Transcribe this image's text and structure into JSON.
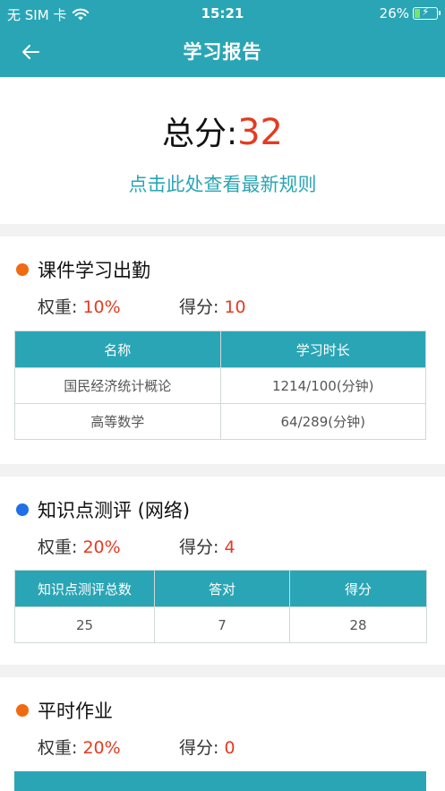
{
  "status_bar": {
    "carrier": "无 SIM 卡",
    "time": "15:21",
    "battery": "26%"
  },
  "nav": {
    "title": "学习报告"
  },
  "summary": {
    "total_label": "总分:",
    "total_value": "32",
    "rules_link": "点击此处查看最新规则"
  },
  "sections": [
    {
      "title": "课件学习出勤",
      "dot_color": "#f06a12",
      "weight_label": "权重:",
      "weight_value": "10%",
      "score_label": "得分:",
      "score_value": "10",
      "headers": [
        "名称",
        "学习时长"
      ],
      "rows": [
        [
          "国民经济统计概论",
          "1214/100(分钟)"
        ],
        [
          "高等数学",
          "64/289(分钟)"
        ]
      ]
    },
    {
      "title": "知识点测评 (网络)",
      "dot_color": "#1e6fe8",
      "weight_label": "权重:",
      "weight_value": "20%",
      "score_label": "得分:",
      "score_value": "4",
      "headers": [
        "知识点测评总数",
        "答对",
        "得分"
      ],
      "rows": [
        [
          "25",
          "7",
          "28"
        ]
      ]
    },
    {
      "title": "平时作业",
      "dot_color": "#f06a12",
      "weight_label": "权重:",
      "weight_value": "20%",
      "score_label": "得分:",
      "score_value": "0"
    }
  ],
  "colors": {
    "accent": "#2aa5b5",
    "score_red": "#e53a21"
  },
  "icons": {
    "back": "arrow-left-icon",
    "wifi": "wifi-icon",
    "battery": "battery-charging-icon"
  }
}
